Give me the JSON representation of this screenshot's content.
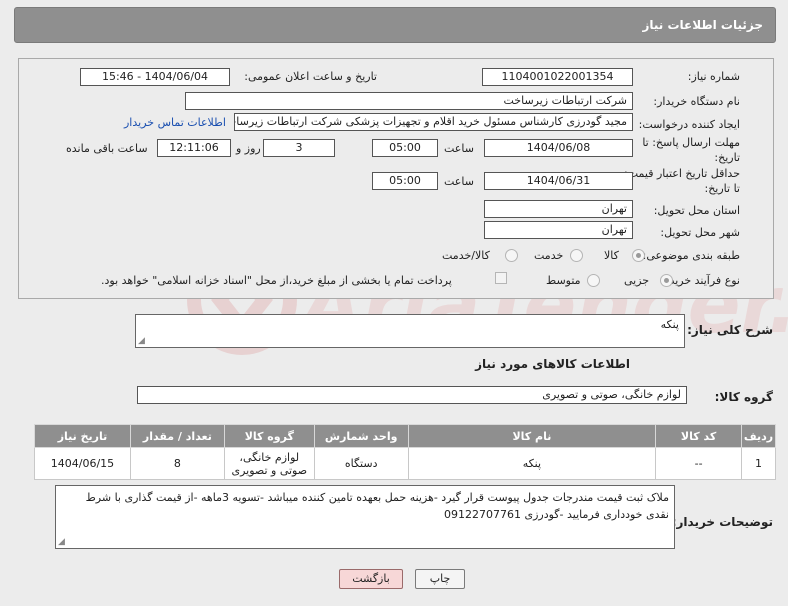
{
  "header": {
    "title": "جزئیات اطلاعات نیاز"
  },
  "form": {
    "need_number_label": "شماره نیاز:",
    "need_number": "1104001022001354",
    "announce_label": "تاریخ و ساعت اعلان عمومی:",
    "announce_value": "1404/06/04 - 15:46",
    "buyer_org_label": "نام دستگاه خریدار:",
    "buyer_org": "شرکت ارتباطات زیرساخت",
    "requester_label": "ایجاد کننده درخواست:",
    "requester": "مجید گودرزی کارشناس مسئول خرید اقلام و تجهیزات پزشکی شرکت ارتباطات زیرساخت",
    "buyer_contact_link": "اطلاعات تماس خریدار",
    "deadline_label_1": "مهلت ارسال پاسخ: تا",
    "deadline_label_2": "تاریخ:",
    "deadline_date": "1404/06/08",
    "time_word": "ساعت",
    "deadline_time": "05:00",
    "days_value": "3",
    "days_word": "روز و",
    "remaining_time": "12:11:06",
    "remaining_word": "ساعت باقی مانده",
    "validity_label_1": "حداقل تاریخ اعتبار قیمت:",
    "validity_label_2": "تا تاریخ:",
    "validity_date": "1404/06/31",
    "validity_time": "05:00",
    "province_label": "استان محل تحویل:",
    "province": "تهران",
    "city_label": "شهر محل تحویل:",
    "city": "تهران",
    "category_label": "طبقه بندی موضوعی:",
    "category_options": [
      "کالا",
      "خدمت",
      "کالا/خدمت"
    ],
    "process_label": "نوع فرآیند خرید :",
    "process_options": [
      "جزیی",
      "متوسط"
    ],
    "payment_note": "پرداخت تمام یا بخشی از مبلغ خرید،از محل \"اسناد خزانه اسلامی\" خواهد بود."
  },
  "summary": {
    "label": "شرح کلی نیاز:",
    "value": "پنکه"
  },
  "goods_section": {
    "title": "اطلاعات کالاهای مورد نیاز",
    "group_label": "گروه کالا:",
    "group_value": "لوازم خانگی، صوتی و تصویری"
  },
  "table": {
    "headers": [
      "ردیف",
      "کد کالا",
      "نام کالا",
      "واحد شمارش",
      "گروه کالا",
      "تعداد / مقدار",
      "تاریخ نیاز"
    ],
    "rows": [
      [
        "1",
        "--",
        "پنکه",
        "دستگاه",
        "لوازم خانگی، صوتی و تصویری",
        "8",
        "1404/06/15"
      ]
    ]
  },
  "notes": {
    "label": "توضیحات خریدار:",
    "value": "ملاک ثبت قیمت مندرجات جدول پیوست قرار گیرد -هزینه حمل بعهده تامین کننده میباشد -تسویه 3ماهه -از قیمت گذاری با شرط نقدی خودداری فرمایید -گودرزی 09122707761"
  },
  "buttons": {
    "print": "چاپ",
    "back": "بازگشت"
  },
  "watermark": {
    "text": "AriaTender.net"
  },
  "colors": {
    "header_bg": "#8f8f8f",
    "link": "#1a4fb0",
    "back_button": "#f7d7d7"
  }
}
